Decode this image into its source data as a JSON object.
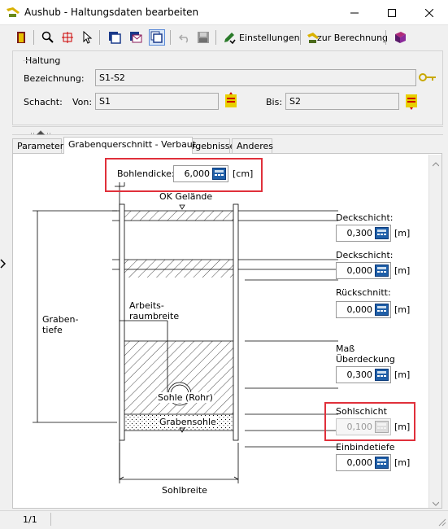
{
  "window": {
    "title": "Aushub - Haltungsdaten bearbeiten"
  },
  "toolbar": {
    "einstellungen_label": "Einstellungen",
    "berechnung_label": "zur Berechnung"
  },
  "haltung": {
    "group_label": "Haltung",
    "bezeichnung_label": "Bezeichnung:",
    "bezeichnung_value": "S1-S2",
    "schacht_label": "Schacht:",
    "von_label": "Von:",
    "von_value": "S1",
    "bis_label": "Bis:",
    "bis_value": "S2"
  },
  "tabs": [
    {
      "label": "Parameter"
    },
    {
      "label": "Grabenquerschnitt - Verbaut"
    },
    {
      "label": "Ergebnisse"
    },
    {
      "label": "Anderes"
    }
  ],
  "diagram": {
    "bohlendicke_label": "Bohlendicke:",
    "bohlendicke_value": "6,000",
    "bohlendicke_unit": "[cm]",
    "ok_gelaende": "OK Gelände",
    "grabentiefe_1": "Graben-",
    "grabentiefe_2": "tiefe",
    "arbeitsraum_1": "Arbeits-",
    "arbeitsraum_2": "raumbreite",
    "sohle_rohr": "Sohle (Rohr)",
    "grabensohle": "Grabensohle",
    "sohlbreite": "Sohlbreite"
  },
  "fields": [
    {
      "label": "Deckschicht:",
      "value": "0,300",
      "unit": "[m]"
    },
    {
      "label": "Deckschicht:",
      "value": "0,000",
      "unit": "[m]"
    },
    {
      "label": "Rückschnitt:",
      "value": "0,000",
      "unit": "[m]"
    },
    {
      "label": "Maß",
      "label2": "Überdeckung",
      "value": "0,300",
      "unit": "[m]"
    },
    {
      "label": "Sohlschicht",
      "value": "0,100",
      "unit": "[m]"
    },
    {
      "label": "Einbindetiefe",
      "value": "0,000",
      "unit": "[m]"
    }
  ],
  "status": {
    "page": "1/1"
  },
  "colors": {
    "highlight_border": "#e0303b",
    "calc_icon": "#1f5fa8"
  }
}
